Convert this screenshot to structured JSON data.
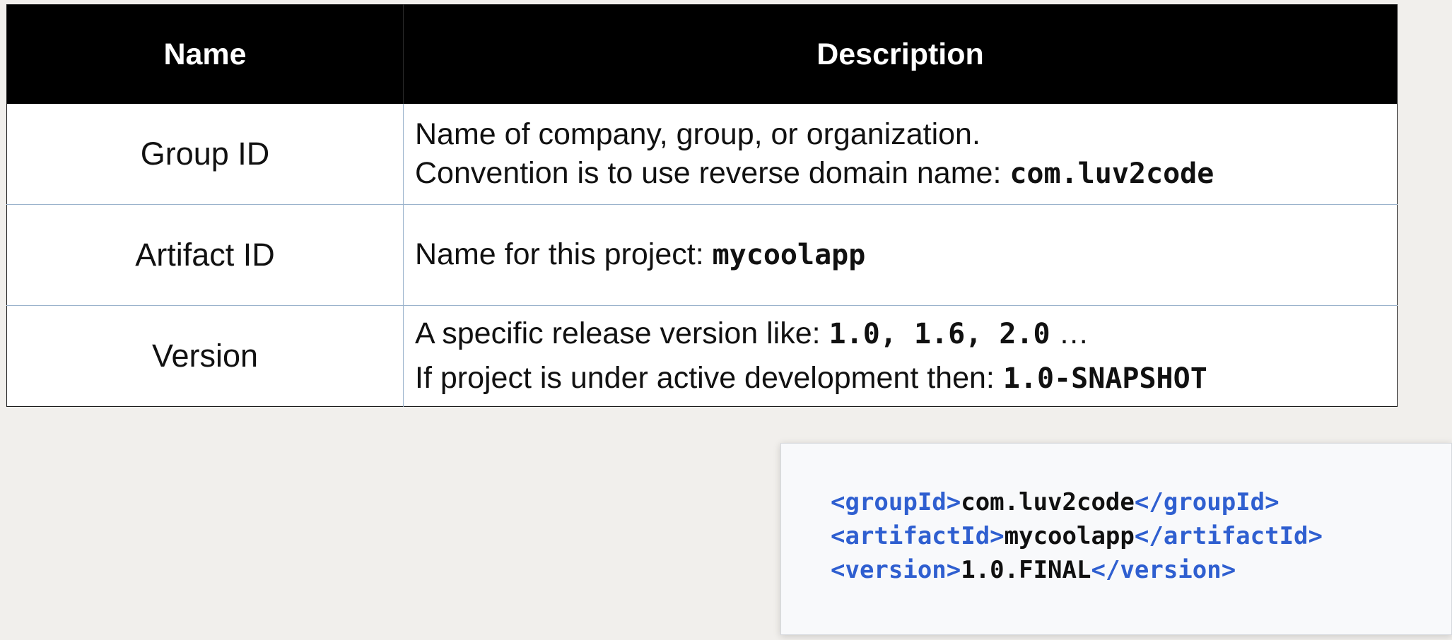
{
  "table": {
    "headers": {
      "name": "Name",
      "description": "Description"
    },
    "rows": [
      {
        "name": "Group ID",
        "lines": [
          {
            "text": "Name of company, group, or organization.",
            "code": "",
            "suffix": ""
          },
          {
            "text": "Convention is to use reverse domain name: ",
            "code": "com.luv2code",
            "suffix": ""
          }
        ]
      },
      {
        "name": "Artifact ID",
        "lines": [
          {
            "text": "Name for this project: ",
            "code": "mycoolapp",
            "suffix": ""
          }
        ]
      },
      {
        "name": "Version",
        "lines": [
          {
            "text": "A specific release version like: ",
            "code": "1.0, 1.6, 2.0",
            "suffix": " …"
          },
          {
            "text": "If project is under active development then: ",
            "code": "1.0-SNAPSHOT",
            "suffix": ""
          }
        ]
      }
    ]
  },
  "xml": {
    "lines": [
      {
        "open": "<groupId>",
        "value": "com.luv2code",
        "close": "</groupId>"
      },
      {
        "open": "<artifactId>",
        "value": "mycoolapp",
        "close": "</artifactId>"
      },
      {
        "open": "<version>",
        "value": "1.0.FINAL",
        "close": "</version>"
      }
    ]
  },
  "colors": {
    "xml_tag": "#2f5fd0",
    "header_bg": "#000000",
    "grid_line": "#9bb3cc",
    "page_bg": "#f1efec"
  }
}
